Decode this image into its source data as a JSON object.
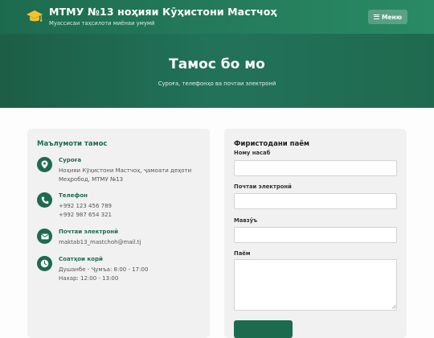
{
  "header": {
    "title": "МТМУ №13 ноҳияи Кӯҳистони Мастчоҳ",
    "subtitle": "Муассисаи таҳсилоти миёнаи умумӣ",
    "menu_label": "Меню",
    "logo_icon": "graduation-cap-icon",
    "logo_color": "#f2c230"
  },
  "hero": {
    "title": "Тамос бо мо",
    "subtitle": "Суроға, телефонҳо ва почтаи электронӣ"
  },
  "info": {
    "title": "Маълумоти тамос",
    "items": [
      {
        "icon": "map-pin-icon",
        "label": "Суроға",
        "lines": [
          "Ноҳияи Кӯҳистони Мастчоҳ, ҷамоати деҳоти",
          "Меҳробод, МТМУ №13"
        ]
      },
      {
        "icon": "phone-icon",
        "label": "Телефон",
        "lines": [
          "+992 123 456 789",
          "+992 987 654 321"
        ]
      },
      {
        "icon": "envelope-icon",
        "label": "Почтаи электронӣ",
        "lines": [
          "maktab13_mastchoh@mail.tj"
        ]
      },
      {
        "icon": "clock-icon",
        "label": "Соатҳои корӣ",
        "lines": [
          "Душанбе - Ҷумъа: 8:00 - 17:00",
          "Нахар: 12:00 - 13:00"
        ]
      }
    ]
  },
  "form": {
    "title": "Фиристодани паём",
    "fields": [
      {
        "label": "Ному насаб",
        "value": "",
        "placeholder": ""
      },
      {
        "label": "Почтаи электронӣ",
        "value": "",
        "placeholder": ""
      },
      {
        "label": "Мавзӯъ",
        "value": "",
        "placeholder": ""
      },
      {
        "label": "Паём",
        "value": "",
        "placeholder": ""
      }
    ],
    "submit_label": ""
  },
  "colors": {
    "brand": "#1d6b4f",
    "hero": "#22725a",
    "card": "#f1f1f1"
  }
}
